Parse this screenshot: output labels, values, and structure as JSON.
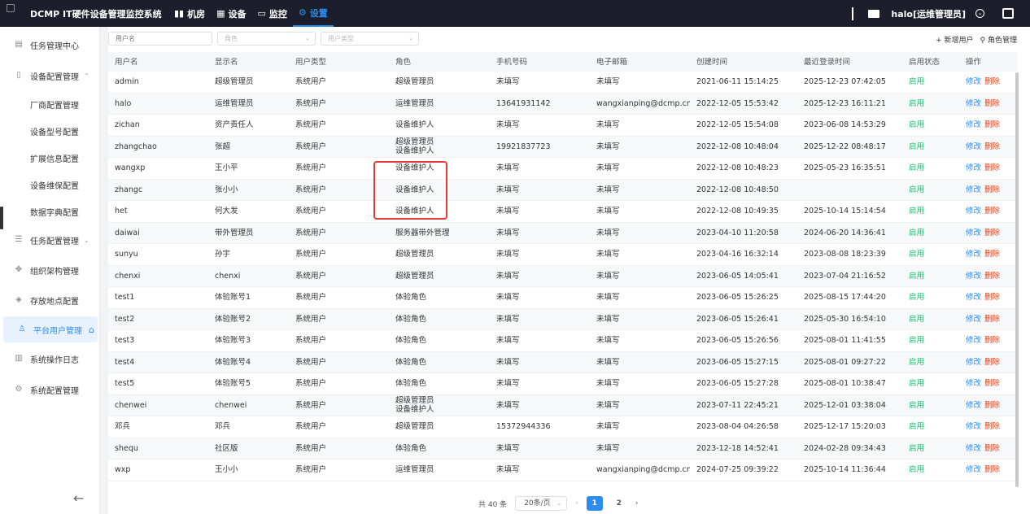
{
  "app": {
    "title": "DCMP IT硬件设备管理监控系统",
    "nav": [
      {
        "label": "机房",
        "icon": "bar-chart-icon"
      },
      {
        "label": "设备",
        "icon": "grid-icon"
      },
      {
        "label": "监控",
        "icon": "monitor-icon"
      },
      {
        "label": "设置",
        "icon": "gear-icon",
        "active": true
      }
    ],
    "user": "halo[运维管理员]",
    "accent": "#2d8cf0"
  },
  "sidebar": {
    "items": [
      {
        "label": "任务管理中心",
        "icon": "task-icon"
      },
      {
        "label": "设备配置管理",
        "icon": "device-icon",
        "chevron": "^"
      },
      {
        "label": "厂商配置管理",
        "sub": true
      },
      {
        "label": "设备型号配置",
        "sub": true
      },
      {
        "label": "扩展信息配置",
        "sub": true
      },
      {
        "label": "设备维保配置",
        "sub": true
      },
      {
        "label": "数据字典配置",
        "sub": true
      },
      {
        "label": "任务配置管理",
        "icon": "sliders-icon",
        "chevron": "v"
      },
      {
        "label": "组织架构管理",
        "icon": "org-icon"
      },
      {
        "label": "存放地点配置",
        "icon": "location-icon"
      },
      {
        "label": "平台用户管理",
        "icon": "user-icon",
        "active": true
      },
      {
        "label": "系统操作日志",
        "icon": "log-icon"
      },
      {
        "label": "系统配置管理",
        "icon": "settings-icon"
      }
    ]
  },
  "filters": {
    "username_placeholder": "用户名",
    "role_placeholder": "角色",
    "usertype_placeholder": "用户类型"
  },
  "actions": {
    "add_user": "+ 新增用户",
    "role_manage": "角色管理"
  },
  "table": {
    "headers": [
      "用户名",
      "显示名",
      "用户类型",
      "角色",
      "手机号码",
      "电子邮箱",
      "创建时间",
      "最近登录时间",
      "启用状态",
      "操作"
    ],
    "rows": [
      {
        "username": "admin",
        "display": "超级管理员",
        "type": "系统用户",
        "role": "超级管理员",
        "role2": "",
        "phone": "未填写",
        "email": "未填写",
        "created": "2021-06-11 15:14:25",
        "lastlogin": "2025-12-23 07:42:05",
        "status": "启用"
      },
      {
        "username": "halo",
        "display": "运维管理员",
        "type": "系统用户",
        "role": "运维管理员",
        "role2": "",
        "phone": "13641931142",
        "email": "wangxianping@dcmp.cn",
        "created": "2022-12-05 15:53:42",
        "lastlogin": "2025-12-23 16:11:21",
        "status": "启用"
      },
      {
        "username": "zichan",
        "display": "资产责任人",
        "type": "系统用户",
        "role": "设备维护人",
        "role2": "",
        "phone": "未填写",
        "email": "未填写",
        "created": "2022-12-05 15:54:08",
        "lastlogin": "2023-06-08 14:53:29",
        "status": "启用"
      },
      {
        "username": "zhangchao",
        "display": "张超",
        "type": "系统用户",
        "role": "超级管理员",
        "role2": "设备维护人",
        "phone": "19921837723",
        "email": "未填写",
        "created": "2022-12-08 10:48:04",
        "lastlogin": "2025-12-22 08:48:17",
        "status": "启用"
      },
      {
        "username": "wangxp",
        "display": "王小平",
        "type": "系统用户",
        "role": "设备维护人",
        "role2": "",
        "phone": "未填写",
        "email": "未填写",
        "created": "2022-12-08 10:48:23",
        "lastlogin": "2025-05-23 16:35:51",
        "status": "启用"
      },
      {
        "username": "zhangc",
        "display": "张小小",
        "type": "系统用户",
        "role": "设备维护人",
        "role2": "",
        "phone": "未填写",
        "email": "未填写",
        "created": "2022-12-08 10:48:50",
        "lastlogin": "",
        "status": "启用"
      },
      {
        "username": "het",
        "display": "何大发",
        "type": "系统用户",
        "role": "设备维护人",
        "role2": "",
        "phone": "未填写",
        "email": "未填写",
        "created": "2022-12-08 10:49:35",
        "lastlogin": "2025-10-14 15:14:54",
        "status": "启用"
      },
      {
        "username": "daiwai",
        "display": "带外管理员",
        "type": "系统用户",
        "role": "服务器带外管理",
        "role2": "",
        "phone": "未填写",
        "email": "未填写",
        "created": "2023-04-10 11:20:58",
        "lastlogin": "2024-06-20 14:36:41",
        "status": "启用"
      },
      {
        "username": "sunyu",
        "display": "孙宇",
        "type": "系统用户",
        "role": "超级管理员",
        "role2": "",
        "phone": "未填写",
        "email": "未填写",
        "created": "2023-04-16 16:32:14",
        "lastlogin": "2023-08-08 18:23:39",
        "status": "启用"
      },
      {
        "username": "chenxi",
        "display": "chenxi",
        "type": "系统用户",
        "role": "超级管理员",
        "role2": "",
        "phone": "未填写",
        "email": "未填写",
        "created": "2023-06-05 14:05:41",
        "lastlogin": "2023-07-04 21:16:52",
        "status": "启用"
      },
      {
        "username": "test1",
        "display": "体验账号1",
        "type": "系统用户",
        "role": "体验角色",
        "role2": "",
        "phone": "未填写",
        "email": "未填写",
        "created": "2023-06-05 15:26:25",
        "lastlogin": "2025-08-15 17:44:20",
        "status": "启用"
      },
      {
        "username": "test2",
        "display": "体验账号2",
        "type": "系统用户",
        "role": "体验角色",
        "role2": "",
        "phone": "未填写",
        "email": "未填写",
        "created": "2023-06-05 15:26:41",
        "lastlogin": "2025-05-30 16:54:10",
        "status": "启用"
      },
      {
        "username": "test3",
        "display": "体验账号3",
        "type": "系统用户",
        "role": "体验角色",
        "role2": "",
        "phone": "未填写",
        "email": "未填写",
        "created": "2023-06-05 15:26:56",
        "lastlogin": "2025-08-01 11:41:55",
        "status": "启用"
      },
      {
        "username": "test4",
        "display": "体验账号4",
        "type": "系统用户",
        "role": "体验角色",
        "role2": "",
        "phone": "未填写",
        "email": "未填写",
        "created": "2023-06-05 15:27:15",
        "lastlogin": "2025-08-01 09:27:22",
        "status": "启用"
      },
      {
        "username": "test5",
        "display": "体验账号5",
        "type": "系统用户",
        "role": "体验角色",
        "role2": "",
        "phone": "未填写",
        "email": "未填写",
        "created": "2023-06-05 15:27:28",
        "lastlogin": "2025-08-01 10:38:47",
        "status": "启用"
      },
      {
        "username": "chenwei",
        "display": "chenwei",
        "type": "系统用户",
        "role": "超级管理员",
        "role2": "设备维护人",
        "phone": "未填写",
        "email": "未填写",
        "created": "2023-07-11 22:45:21",
        "lastlogin": "2025-12-01 03:38:04",
        "status": "启用"
      },
      {
        "username": "邓兵",
        "display": "邓兵",
        "type": "系统用户",
        "role": "超级管理员",
        "role2": "",
        "phone": "15372944336",
        "email": "未填写",
        "created": "2023-08-04 04:26:58",
        "lastlogin": "2025-12-17 15:20:03",
        "status": "启用"
      },
      {
        "username": "shequ",
        "display": "社区版",
        "type": "系统用户",
        "role": "体验角色",
        "role2": "",
        "phone": "未填写",
        "email": "未填写",
        "created": "2023-12-18 14:52:41",
        "lastlogin": "2024-02-28 09:34:43",
        "status": "启用"
      },
      {
        "username": "wxp",
        "display": "王小小",
        "type": "系统用户",
        "role": "运维管理员",
        "role2": "",
        "phone": "未填写",
        "email": "wangxianping@dcmp.cn",
        "created": "2024-07-25 09:39:22",
        "lastlogin": "2025-10-14 11:36:44",
        "status": "启用"
      }
    ],
    "edit_label": "修改",
    "delete_label": "删除"
  },
  "pagination": {
    "total": "共 40 条",
    "page_size": "20条/页",
    "pages": [
      "1",
      "2"
    ],
    "current": "1",
    "prev": "‹",
    "next": "›"
  }
}
